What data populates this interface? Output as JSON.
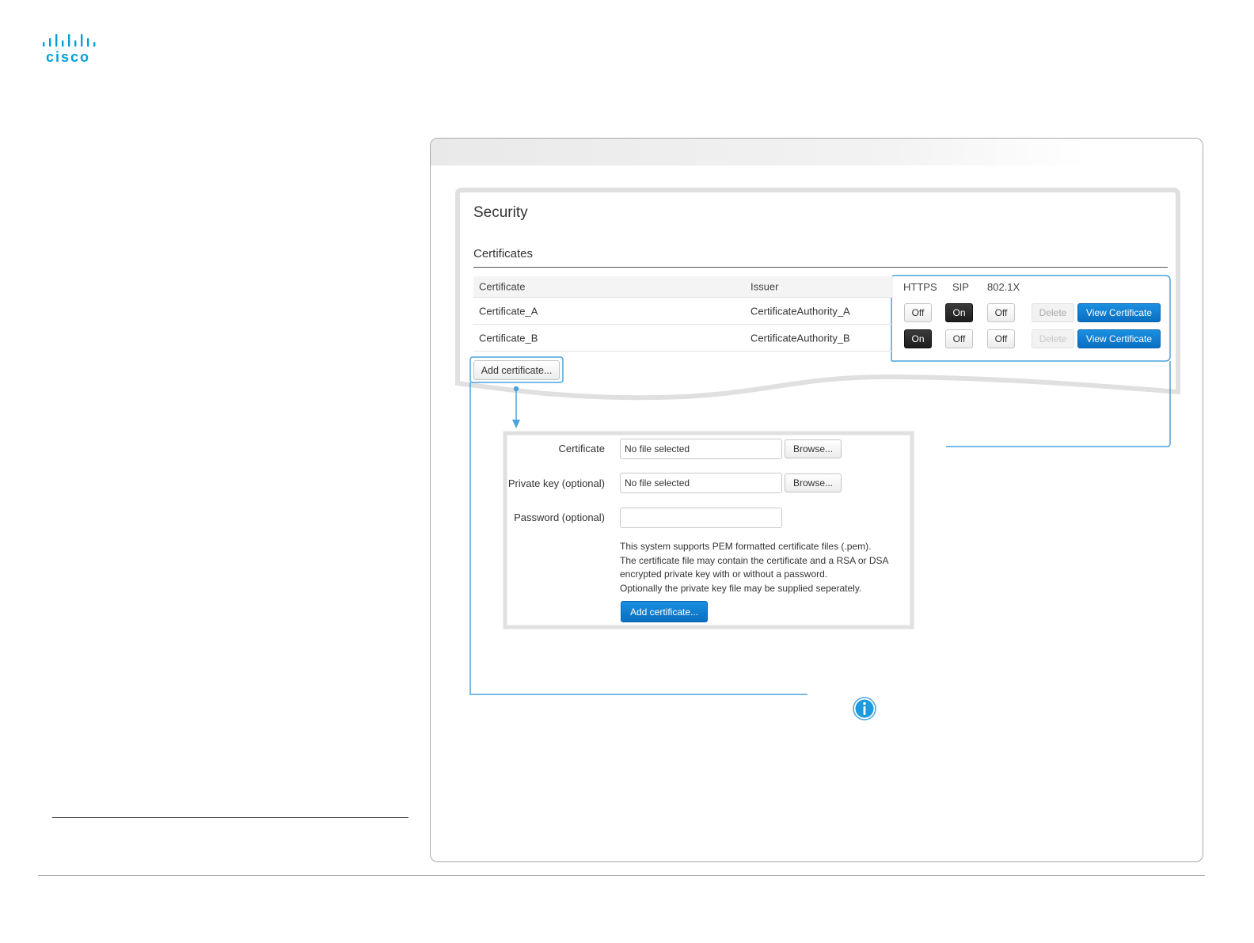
{
  "brand": {
    "logo_text": "cisco",
    "color": "#049fd9"
  },
  "section": {
    "title": "Security",
    "subtitle": "Certificates"
  },
  "table": {
    "headers": {
      "certificate": "Certificate",
      "issuer": "Issuer",
      "https": "HTTPS",
      "sip": "SIP",
      "dot1x": "802.1X"
    },
    "rows": [
      {
        "certificate": "Certificate_A",
        "issuer": "CertificateAuthority_A",
        "https": "Off",
        "sip": "On",
        "dot1x": "Off",
        "delete": "Delete",
        "view": "View Certificate"
      },
      {
        "certificate": "Certificate_B",
        "issuer": "CertificateAuthority_B",
        "https": "On",
        "sip": "Off",
        "dot1x": "Off",
        "delete": "Delete",
        "view": "View Certificate"
      }
    ],
    "add_button": "Add certificate..."
  },
  "form": {
    "certificate_label": "Certificate",
    "certificate_value": "No file selected",
    "private_key_label": "Private key (optional)",
    "private_key_value": "No file selected",
    "password_label": "Password (optional)",
    "password_value": "",
    "browse_label": "Browse...",
    "help_lines": [
      "This system supports PEM formatted certificate files (.pem).",
      "The certificate file may contain the certificate and a RSA or DSA",
      "encrypted private key with or without a password.",
      "Optionally the private key file may be supplied seperately."
    ],
    "submit_label": "Add certificate..."
  },
  "colors": {
    "accent": "#4aa3df",
    "primary_button": "#0a78d0",
    "toggle_on": "#222222"
  },
  "icons": {
    "info": "info-icon"
  }
}
